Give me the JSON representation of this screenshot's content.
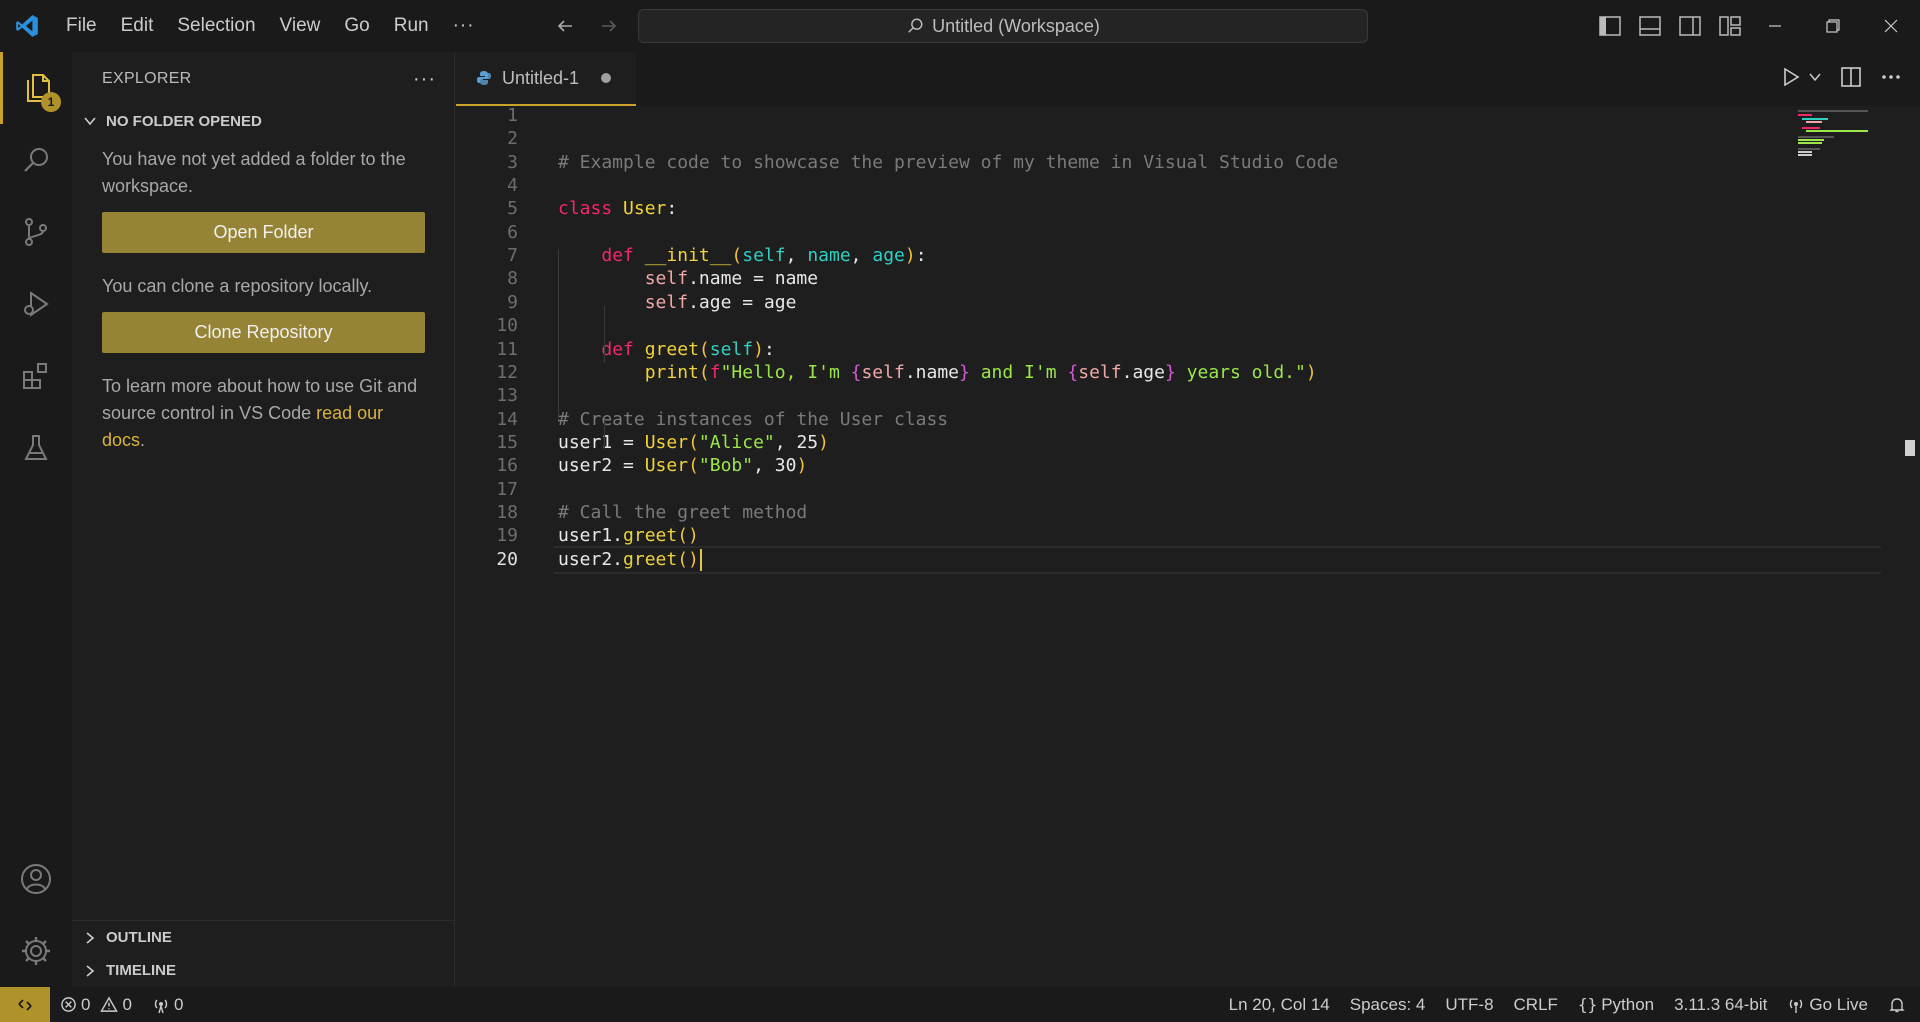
{
  "menu": [
    "File",
    "Edit",
    "Selection",
    "View",
    "Go",
    "Run",
    "···"
  ],
  "command_center": "Untitled (Workspace)",
  "activity": {
    "explorer_badge": "1"
  },
  "sidebar": {
    "title": "EXPLORER",
    "more": "···",
    "section": "NO FOLDER OPENED",
    "text1": "You have not yet added a folder to the workspace.",
    "open_folder": "Open Folder",
    "text2": "You can clone a repository locally.",
    "clone_repo": "Clone Repository",
    "text3": "To learn more about how to use Git and source control in VS Code ",
    "text3_link": "read our docs",
    "text3_end": ".",
    "outline": "OUTLINE",
    "timeline": "TIMELINE"
  },
  "tab": {
    "label": "Untitled-1"
  },
  "editor": {
    "line_numbers": [
      "1",
      "2",
      "3",
      "4",
      "5",
      "6",
      "7",
      "8",
      "9",
      "10",
      "11",
      "12",
      "13",
      "14",
      "15",
      "16",
      "17",
      "18",
      "19",
      "20"
    ],
    "current_line": 20,
    "lines": [
      [],
      [],
      [
        [
          "c-comment",
          "# Example code to showcase the preview of my theme in Visual Studio Code"
        ]
      ],
      [],
      [
        [
          "c-kw",
          "class "
        ],
        [
          "c-cls",
          "User"
        ],
        [
          "",
          ":"
        ]
      ],
      [],
      [
        [
          "",
          "    "
        ],
        [
          "c-kw",
          "def "
        ],
        [
          "c-fn",
          "__init__"
        ],
        [
          "c-br1",
          "("
        ],
        [
          "c-param",
          "self"
        ],
        [
          "",
          ", "
        ],
        [
          "c-param",
          "name"
        ],
        [
          "",
          ", "
        ],
        [
          "c-param",
          "age"
        ],
        [
          "c-br1",
          ")"
        ],
        [
          "",
          ":"
        ]
      ],
      [
        [
          "",
          "        "
        ],
        [
          "c-self",
          "self"
        ],
        [
          "",
          ".name = name"
        ]
      ],
      [
        [
          "",
          "        "
        ],
        [
          "c-self",
          "self"
        ],
        [
          "",
          ".age = age"
        ]
      ],
      [],
      [
        [
          "",
          "    "
        ],
        [
          "c-kw",
          "def "
        ],
        [
          "c-fn",
          "greet"
        ],
        [
          "c-br1",
          "("
        ],
        [
          "c-param",
          "self"
        ],
        [
          "c-br1",
          ")"
        ],
        [
          "",
          ":"
        ]
      ],
      [
        [
          "",
          "        "
        ],
        [
          "c-fn",
          "print"
        ],
        [
          "c-br1",
          "("
        ],
        [
          "c-fs",
          "f"
        ],
        [
          "c-str",
          "\"Hello, I'm "
        ],
        [
          "c-br2",
          "{"
        ],
        [
          "c-self",
          "self"
        ],
        [
          "",
          ".name"
        ],
        [
          "c-br2",
          "}"
        ],
        [
          "c-str",
          " and I'm "
        ],
        [
          "c-br2",
          "{"
        ],
        [
          "c-self",
          "self"
        ],
        [
          "",
          ".age"
        ],
        [
          "c-br2",
          "}"
        ],
        [
          "c-str",
          " years old.\""
        ],
        [
          "c-br1",
          ")"
        ]
      ],
      [],
      [
        [
          "c-comment",
          "# Create instances of the User class"
        ]
      ],
      [
        [
          "",
          "user1 = "
        ],
        [
          "c-cls",
          "User"
        ],
        [
          "c-br1",
          "("
        ],
        [
          "c-str",
          "\"Alice\""
        ],
        [
          "",
          ", 25"
        ],
        [
          "c-br1",
          ")"
        ]
      ],
      [
        [
          "",
          "user2 = "
        ],
        [
          "c-cls",
          "User"
        ],
        [
          "c-br1",
          "("
        ],
        [
          "c-str",
          "\"Bob\""
        ],
        [
          "",
          ", 30"
        ],
        [
          "c-br1",
          ")"
        ]
      ],
      [],
      [
        [
          "c-comment",
          "# Call the greet method"
        ]
      ],
      [
        [
          "",
          "user1."
        ],
        [
          "c-fn",
          "greet"
        ],
        [
          "c-br1",
          "()"
        ]
      ],
      [
        [
          "",
          "user2."
        ],
        [
          "c-fn",
          "greet"
        ],
        [
          "c-br1",
          "()"
        ]
      ]
    ]
  },
  "status": {
    "errors": "0",
    "warnings": "0",
    "ports": "0",
    "position": "Ln 20, Col 14",
    "spaces": "Spaces: 4",
    "encoding": "UTF-8",
    "eol": "CRLF",
    "language": "Python",
    "interpreter": "3.11.3 64-bit",
    "golive": "Go Live"
  },
  "colors": {
    "accent": "#c9a227",
    "button": "#958436",
    "keyword": "#f5266a",
    "function": "#f0d23a",
    "param": "#2fd0c2",
    "string": "#9ce64a",
    "comment": "#7a7a7a"
  }
}
